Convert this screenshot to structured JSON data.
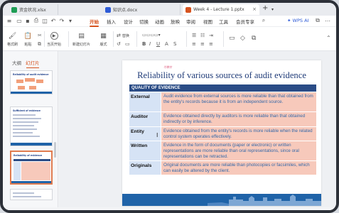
{
  "tabs": [
    {
      "label": "资金状况.xlsx",
      "color": "#1f9d55"
    },
    {
      "label": "知识点.docx",
      "color": "#2e5bd6"
    },
    {
      "label": "Week 4 - Lecture 1.pptx",
      "color": "#d6531f",
      "active": true
    }
  ],
  "menu": {
    "items": [
      "开始",
      "插入",
      "设计",
      "切换",
      "动画",
      "放映",
      "审阅",
      "视图",
      "工具",
      "会员专享"
    ],
    "active": "开始",
    "ai_label": "WPS AI"
  },
  "ribbon": {
    "format_painter": "格式刷",
    "paste": "粘贴",
    "play_from_current": "当页开始",
    "new_slide": "新建幻灯片",
    "layout": "版式",
    "replace": "替换"
  },
  "left_panel": {
    "tab_outline": "大纲",
    "tab_slides": "幻灯片",
    "active_tab": "幻灯片",
    "thumbnails": [
      {
        "number": "",
        "title": "Reliability of audit evidence"
      },
      {
        "number": "",
        "title": "Sufficient of evidence"
      },
      {
        "number": "",
        "title": "Reliability of evidence",
        "selected": true
      },
      {
        "number": "",
        "title": ""
      }
    ]
  },
  "slide": {
    "title": "Reliability of various sources of audit evidence",
    "annotation": "可靠性",
    "header": "QUALITY OF EVIDENCE",
    "rows": [
      {
        "label": "External",
        "text": "Audit evidence from external sources is more reliable than that obtained from the entity's records because it is from an independent source."
      },
      {
        "label": "Auditor",
        "text": "Evidence obtained directly by auditors is more reliable than that obtained indirectly or by inference."
      },
      {
        "label": "Entity",
        "text": "Evidence obtained from the entity's records is more reliable when the related control system operates effectively."
      },
      {
        "label": "Written",
        "text": "Evidence in the form of documents (paper or electronic) or written representations are more reliable than oral representations, since oral representations can be retracted."
      },
      {
        "label": "Originals",
        "text": "Original documents are more reliable than photocopies or facsimiles, which can easily be altered by the client."
      }
    ]
  }
}
